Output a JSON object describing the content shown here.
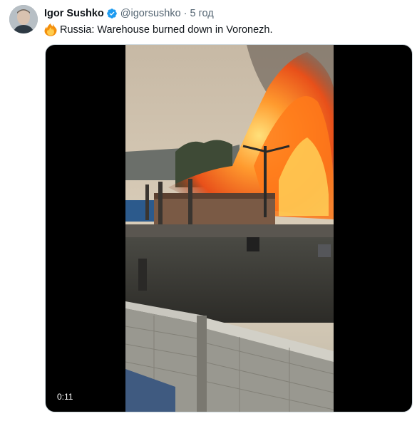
{
  "tweet": {
    "author_name": "Igor Sushko",
    "handle": "@igorsushko",
    "separator": "·",
    "time": "5 год",
    "text": "Russia: Warehouse burned down in Voronezh.",
    "emoji": "fire-emoji",
    "verified_icon": "verified-badge-icon"
  },
  "media": {
    "type": "video",
    "duration": "0:11"
  },
  "colors": {
    "name": "#0f1419",
    "secondary": "#536471",
    "verified": "#1d9bf0",
    "media_border": "#cfd9de"
  }
}
